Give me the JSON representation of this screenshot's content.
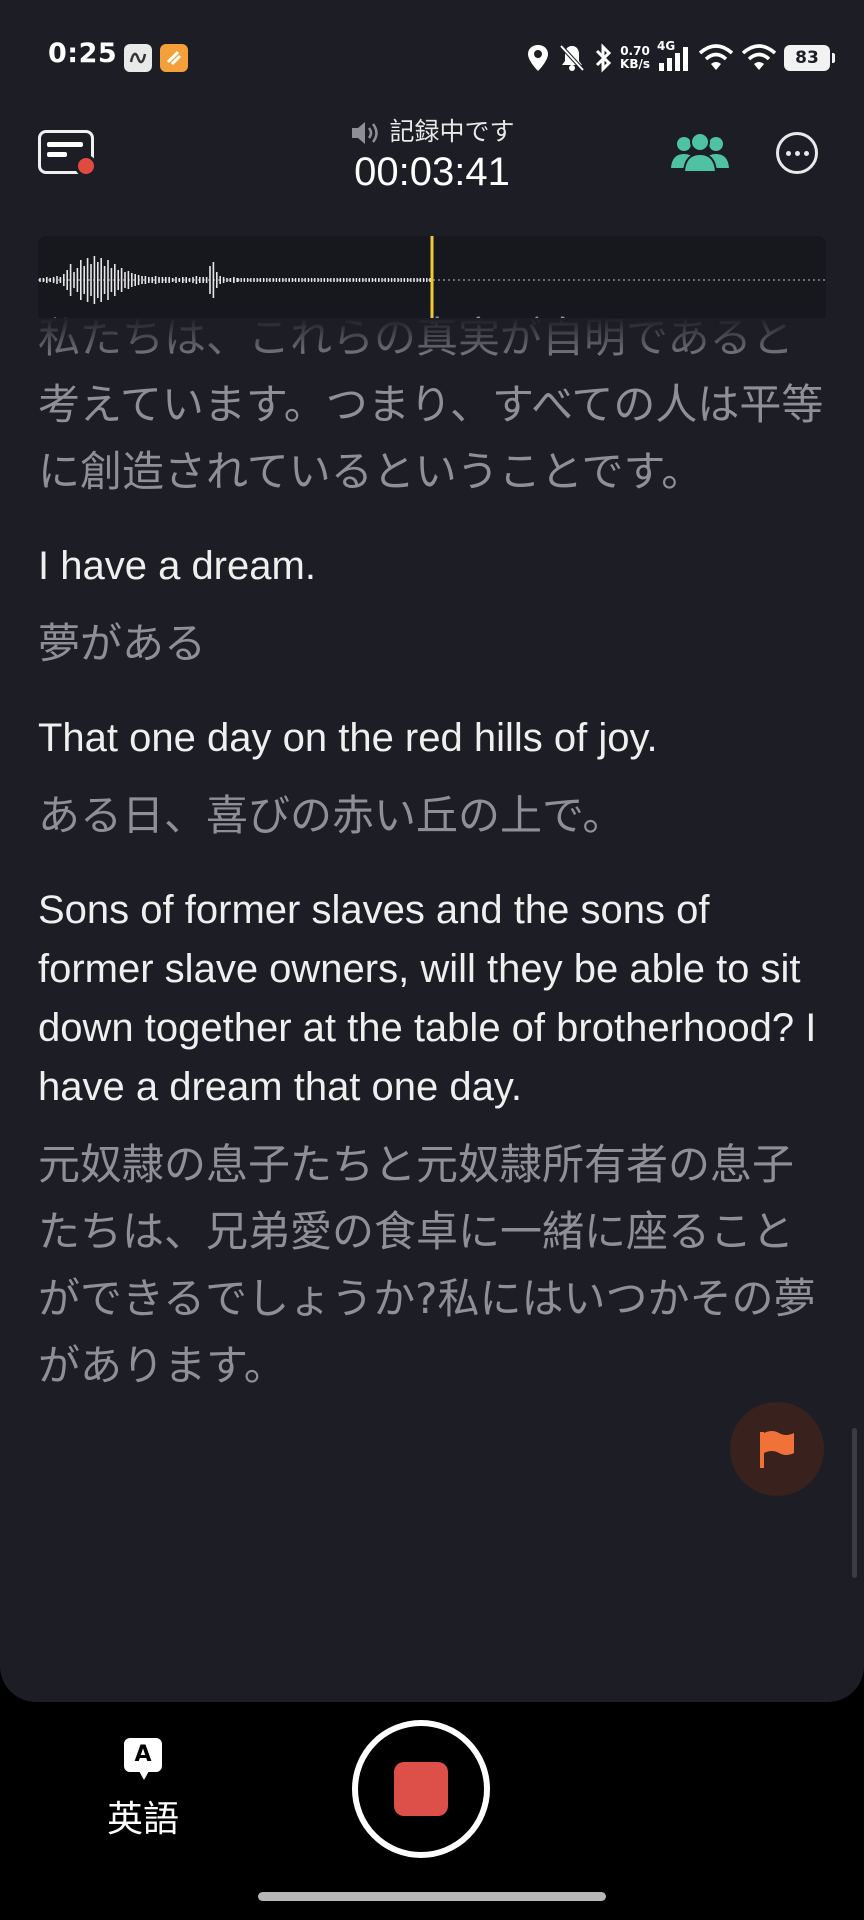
{
  "status_bar": {
    "time": "0:25",
    "net_speed_value": "0.70",
    "net_speed_unit": "KB/s",
    "network": "4G",
    "battery": "83"
  },
  "header": {
    "recording_status": "記録中です",
    "timer": "00:03:41",
    "accent_color": "#4fc3a1"
  },
  "transcript": {
    "segments": [
      {
        "jp": "私たちは、これらの真実が自明であると考えています。つまり、すべての人は平等に創造されているということです。"
      },
      {
        "en": "I have a dream.",
        "jp": "夢がある"
      },
      {
        "en": "That one day on the red hills of joy.",
        "jp": "ある日、喜びの赤い丘の上で。"
      },
      {
        "en": "Sons of former slaves and the sons of former slave owners, will they be able to sit down together at the table of brotherhood? I have a dream that one day.",
        "jp": "元奴隷の息子たちと元奴隷所有者の息子たちは、兄弟愛の食卓に一緒に座ることができるでしょうか?私にはいつかその夢があります。"
      }
    ]
  },
  "bottom_bar": {
    "lang_icon_letter": "A",
    "language_label": "英語",
    "record_color": "#dd4f49"
  }
}
